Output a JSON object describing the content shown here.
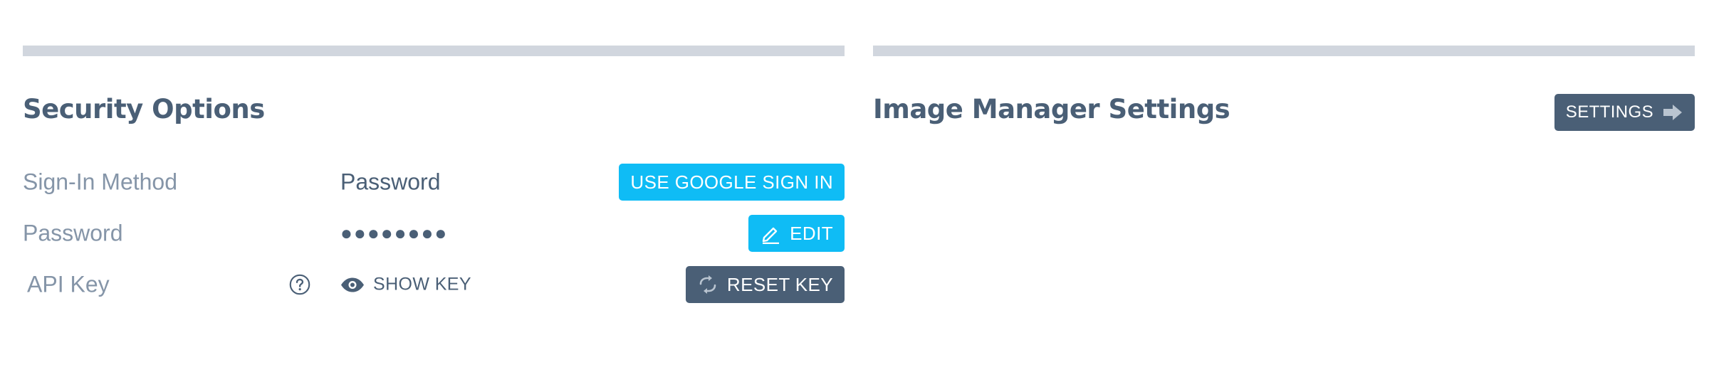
{
  "security": {
    "title": "Security Options",
    "rows": {
      "signin": {
        "label": "Sign-In Method",
        "value": "Password",
        "button": "USE GOOGLE SIGN IN"
      },
      "password": {
        "label": "Password",
        "value": "●●●●●●●●",
        "button": "EDIT"
      },
      "apikey": {
        "label": "API Key",
        "show_label": "SHOW KEY",
        "button": "RESET KEY"
      }
    }
  },
  "image_manager": {
    "title": "Image Manager Settings",
    "button": "SETTINGS"
  },
  "colors": {
    "accent_cyan": "#0fbcf5",
    "slate": "#4a5f76",
    "label_gray": "#8595a8",
    "divider": "#d1d6de"
  },
  "icons": {
    "edit": "pencil-icon",
    "reset": "refresh-icon",
    "settings": "arrow-right-icon",
    "show_key": "eye-icon",
    "help": "help-circle-icon"
  }
}
